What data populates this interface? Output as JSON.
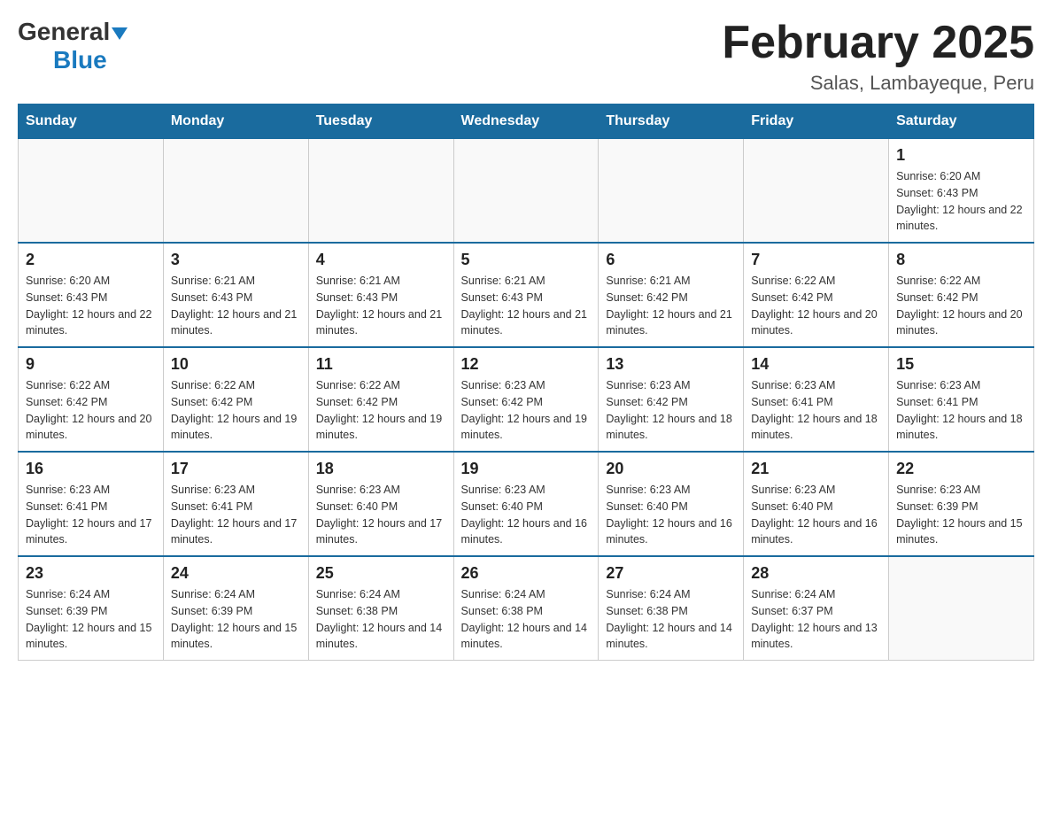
{
  "header": {
    "logo": {
      "general": "General",
      "blue": "Blue",
      "arrow": "▼"
    },
    "title": "February 2025",
    "location": "Salas, Lambayeque, Peru"
  },
  "weekdays": [
    "Sunday",
    "Monday",
    "Tuesday",
    "Wednesday",
    "Thursday",
    "Friday",
    "Saturday"
  ],
  "weeks": [
    [
      {
        "day": "",
        "info": ""
      },
      {
        "day": "",
        "info": ""
      },
      {
        "day": "",
        "info": ""
      },
      {
        "day": "",
        "info": ""
      },
      {
        "day": "",
        "info": ""
      },
      {
        "day": "",
        "info": ""
      },
      {
        "day": "1",
        "info": "Sunrise: 6:20 AM\nSunset: 6:43 PM\nDaylight: 12 hours and 22 minutes."
      }
    ],
    [
      {
        "day": "2",
        "info": "Sunrise: 6:20 AM\nSunset: 6:43 PM\nDaylight: 12 hours and 22 minutes."
      },
      {
        "day": "3",
        "info": "Sunrise: 6:21 AM\nSunset: 6:43 PM\nDaylight: 12 hours and 21 minutes."
      },
      {
        "day": "4",
        "info": "Sunrise: 6:21 AM\nSunset: 6:43 PM\nDaylight: 12 hours and 21 minutes."
      },
      {
        "day": "5",
        "info": "Sunrise: 6:21 AM\nSunset: 6:43 PM\nDaylight: 12 hours and 21 minutes."
      },
      {
        "day": "6",
        "info": "Sunrise: 6:21 AM\nSunset: 6:42 PM\nDaylight: 12 hours and 21 minutes."
      },
      {
        "day": "7",
        "info": "Sunrise: 6:22 AM\nSunset: 6:42 PM\nDaylight: 12 hours and 20 minutes."
      },
      {
        "day": "8",
        "info": "Sunrise: 6:22 AM\nSunset: 6:42 PM\nDaylight: 12 hours and 20 minutes."
      }
    ],
    [
      {
        "day": "9",
        "info": "Sunrise: 6:22 AM\nSunset: 6:42 PM\nDaylight: 12 hours and 20 minutes."
      },
      {
        "day": "10",
        "info": "Sunrise: 6:22 AM\nSunset: 6:42 PM\nDaylight: 12 hours and 19 minutes."
      },
      {
        "day": "11",
        "info": "Sunrise: 6:22 AM\nSunset: 6:42 PM\nDaylight: 12 hours and 19 minutes."
      },
      {
        "day": "12",
        "info": "Sunrise: 6:23 AM\nSunset: 6:42 PM\nDaylight: 12 hours and 19 minutes."
      },
      {
        "day": "13",
        "info": "Sunrise: 6:23 AM\nSunset: 6:42 PM\nDaylight: 12 hours and 18 minutes."
      },
      {
        "day": "14",
        "info": "Sunrise: 6:23 AM\nSunset: 6:41 PM\nDaylight: 12 hours and 18 minutes."
      },
      {
        "day": "15",
        "info": "Sunrise: 6:23 AM\nSunset: 6:41 PM\nDaylight: 12 hours and 18 minutes."
      }
    ],
    [
      {
        "day": "16",
        "info": "Sunrise: 6:23 AM\nSunset: 6:41 PM\nDaylight: 12 hours and 17 minutes."
      },
      {
        "day": "17",
        "info": "Sunrise: 6:23 AM\nSunset: 6:41 PM\nDaylight: 12 hours and 17 minutes."
      },
      {
        "day": "18",
        "info": "Sunrise: 6:23 AM\nSunset: 6:40 PM\nDaylight: 12 hours and 17 minutes."
      },
      {
        "day": "19",
        "info": "Sunrise: 6:23 AM\nSunset: 6:40 PM\nDaylight: 12 hours and 16 minutes."
      },
      {
        "day": "20",
        "info": "Sunrise: 6:23 AM\nSunset: 6:40 PM\nDaylight: 12 hours and 16 minutes."
      },
      {
        "day": "21",
        "info": "Sunrise: 6:23 AM\nSunset: 6:40 PM\nDaylight: 12 hours and 16 minutes."
      },
      {
        "day": "22",
        "info": "Sunrise: 6:23 AM\nSunset: 6:39 PM\nDaylight: 12 hours and 15 minutes."
      }
    ],
    [
      {
        "day": "23",
        "info": "Sunrise: 6:24 AM\nSunset: 6:39 PM\nDaylight: 12 hours and 15 minutes."
      },
      {
        "day": "24",
        "info": "Sunrise: 6:24 AM\nSunset: 6:39 PM\nDaylight: 12 hours and 15 minutes."
      },
      {
        "day": "25",
        "info": "Sunrise: 6:24 AM\nSunset: 6:38 PM\nDaylight: 12 hours and 14 minutes."
      },
      {
        "day": "26",
        "info": "Sunrise: 6:24 AM\nSunset: 6:38 PM\nDaylight: 12 hours and 14 minutes."
      },
      {
        "day": "27",
        "info": "Sunrise: 6:24 AM\nSunset: 6:38 PM\nDaylight: 12 hours and 14 minutes."
      },
      {
        "day": "28",
        "info": "Sunrise: 6:24 AM\nSunset: 6:37 PM\nDaylight: 12 hours and 13 minutes."
      },
      {
        "day": "",
        "info": ""
      }
    ]
  ]
}
